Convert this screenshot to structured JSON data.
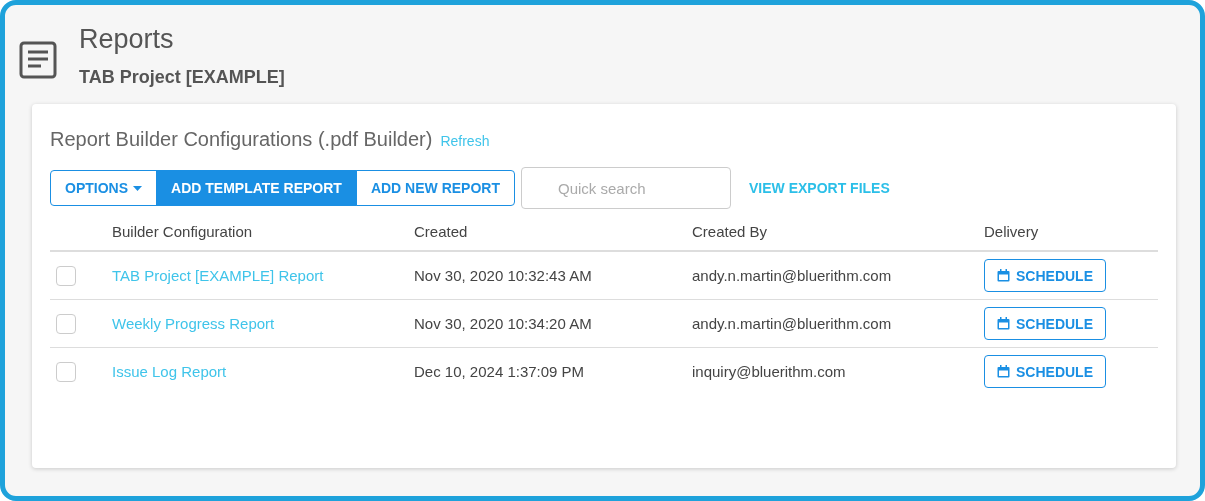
{
  "header": {
    "title": "Reports",
    "subtitle": "TAB Project [EXAMPLE]"
  },
  "card": {
    "title": "Report Builder Configurations (.pdf Builder)",
    "refresh": "Refresh",
    "toolbar": [
      {
        "kind": "dropdown",
        "label": "OPTIONS"
      },
      {
        "kind": "primary",
        "label": "ADD TEMPLATE REPORT"
      },
      {
        "kind": "outline",
        "label": "ADD NEW REPORT"
      }
    ],
    "search": {
      "placeholder": "Quick search"
    },
    "export_link": "VIEW EXPORT FILES",
    "table": {
      "columns": [
        "Builder Configuration",
        "Created",
        "Created By",
        "Delivery"
      ],
      "rows": [
        {
          "checked": false,
          "name": "TAB Project [EXAMPLE] Report",
          "created": "Nov 30, 2020 10:32:43 AM",
          "created_by": "andy.n.martin@bluerithm.com",
          "action": "SCHEDULE"
        },
        {
          "checked": false,
          "name": "Weekly Progress Report",
          "created": "Nov 30, 2020 10:34:20 AM",
          "created_by": "andy.n.martin@bluerithm.com",
          "action": "SCHEDULE"
        },
        {
          "checked": false,
          "name": "Issue Log Report",
          "created": "Dec 10, 2024 1:37:09 PM",
          "created_by": "inquiry@bluerithm.com",
          "action": "SCHEDULE"
        }
      ]
    }
  }
}
